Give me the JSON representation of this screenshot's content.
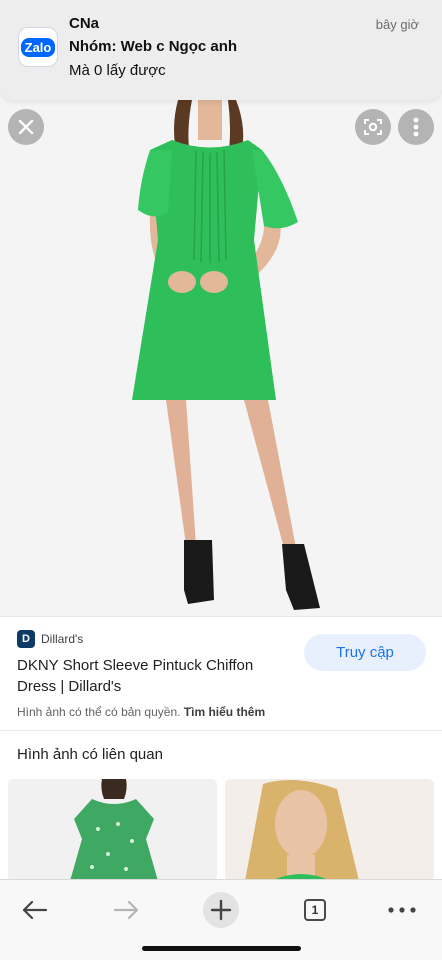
{
  "notification": {
    "app_logo_text": "Zalo",
    "title": "CNa",
    "subtitle": "Nhóm: Web c Ngọc anh",
    "body": "Mà 0 lấy được",
    "time": "bây giờ"
  },
  "image_viewer": {
    "icons": {
      "close": "close-icon",
      "lens": "lens-icon",
      "more": "more-vert-icon"
    }
  },
  "result": {
    "site_icon_letter": "D",
    "site_name": "Dillard's",
    "title": "DKNY Short Sleeve Pintuck Chiffon Dress | Dillard's",
    "visit_label": "Truy cập",
    "copyright_text": "Hình ảnh có thể có bản quyền.",
    "learn_more": "Tìm hiểu thêm"
  },
  "related": {
    "heading": "Hình ảnh có liên quan"
  },
  "toolbar": {
    "tab_count": "1",
    "icons": [
      "back-arrow-icon",
      "forward-arrow-icon",
      "plus-icon",
      "tabs-icon",
      "more-horiz-icon"
    ]
  },
  "colors": {
    "accent": "#1a73e8",
    "accent_bg": "#e8f0fe",
    "dress_green": "#2fbf5a",
    "zalo_blue": "#0068ff"
  }
}
